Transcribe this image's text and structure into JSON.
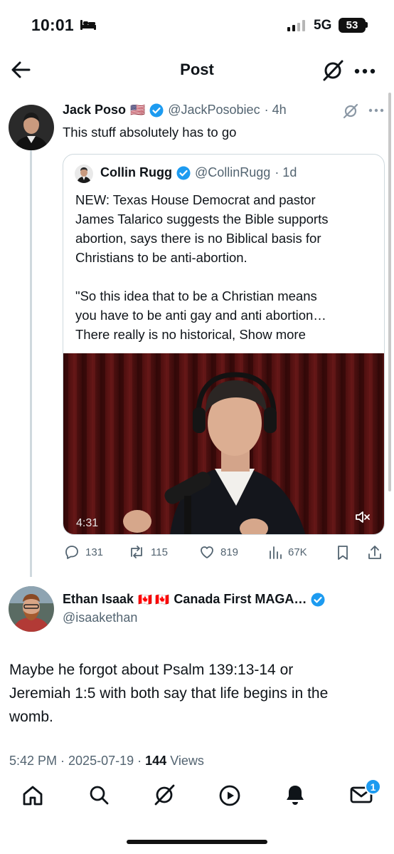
{
  "status": {
    "time": "10:01",
    "network": "5G",
    "battery": "53"
  },
  "nav": {
    "title": "Post"
  },
  "post": {
    "name": "Jack Poso",
    "flag": "🇺🇸",
    "handle": "@JackPosobiec",
    "time": "· 4h",
    "text": "This stuff absolutely has to go"
  },
  "quote": {
    "name": "Collin Rugg",
    "handle": "@CollinRugg",
    "time": "· 1d",
    "lines": [
      "NEW: Texas House Democrat and pastor",
      "James Talarico suggests the Bible supports",
      "abortion, says there is no Biblical basis for",
      "Christians to be anti-abortion.",
      "\"So this idea that to be a Christian means",
      "you have to be anti gay and anti abortion…",
      "There really is no historical,"
    ],
    "show_more": "Show more",
    "video_duration": "4:31"
  },
  "actions": {
    "replies": "131",
    "reposts": "115",
    "likes": "819",
    "views": "67K"
  },
  "reply": {
    "name": "Ethan Isaak",
    "flags": "🇨🇦 🇨🇦",
    "name_suffix": "Canada First MAGA…",
    "handle": "@isaakethan",
    "lines": [
      "Maybe he forgot about Psalm 139:13-14 or",
      "Jeremiah 1:5 with both say that life begins in the",
      "womb."
    ],
    "time": "5:42 PM · 2025-07-19 ·",
    "views_count": "144",
    "views_label": "Views"
  },
  "tabs": {
    "messages_badge": "1"
  },
  "colors": {
    "verified": "#1d9bf0",
    "muted": "#536471",
    "border": "#cfd9de"
  }
}
